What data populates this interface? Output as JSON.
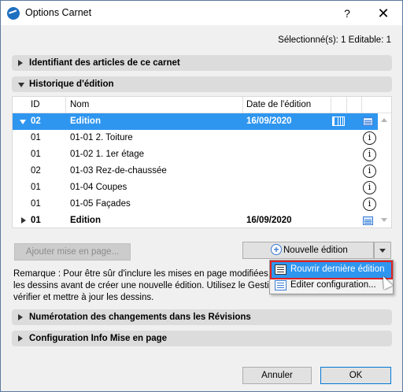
{
  "window": {
    "title": "Options Carnet",
    "help_label": "?",
    "close_label": "✕"
  },
  "selection_info": "Sélectionné(s): 1 Editable: 1",
  "sections": {
    "identifiant": "Identifiant des articles de ce carnet",
    "historique": "Historique d'édition",
    "numerotation": "Numérotation des changements dans les Révisions",
    "config": "Configuration Info Mise en page"
  },
  "table": {
    "headers": {
      "id": "ID",
      "nom": "Nom",
      "date": "Date de l'édition"
    },
    "rows": [
      {
        "id": "02",
        "nom": "Edition",
        "date": "16/09/2020",
        "type": "issue",
        "expanded": true,
        "selected": true
      },
      {
        "id": "01",
        "nom": "01-01 2. Toiture",
        "date": "",
        "type": "layout"
      },
      {
        "id": "01",
        "nom": "01-02 1. 1er étage",
        "date": "",
        "type": "layout"
      },
      {
        "id": "02",
        "nom": "01-03 Rez-de-chaussée",
        "date": "",
        "type": "layout"
      },
      {
        "id": "01",
        "nom": "01-04 Coupes",
        "date": "",
        "type": "layout"
      },
      {
        "id": "01",
        "nom": "01-05 Façades",
        "date": "",
        "type": "layout"
      },
      {
        "id": "01",
        "nom": "Edition",
        "date": "16/09/2020",
        "type": "issue",
        "expanded": false
      }
    ],
    "icons": {
      "row_info": "info-icon",
      "issue_doc": "document-icon",
      "issue_book": "book-icon"
    }
  },
  "buttons": {
    "ajouter": "Ajouter mise en page...",
    "nouvelle": "Nouvelle édition",
    "annuler": "Annuler",
    "ok": "OK"
  },
  "remark": {
    "line1": "Remarque : Pour être sûr d'inclure les mises en page modifiées,",
    "line2": "les dessins avant de créer une nouvelle édition. Utilisez le Gestio",
    "line3": "vérifier et mettre à jour les dessins."
  },
  "menu": {
    "items": [
      {
        "label": "Rouvrir dernière édition",
        "highlighted": true
      },
      {
        "label": "Editer configuration...",
        "highlighted": false
      }
    ]
  },
  "colors": {
    "selection": "#2f96f0",
    "section_bg": "#dcdcdc",
    "highlight_outline": "#e02020"
  }
}
